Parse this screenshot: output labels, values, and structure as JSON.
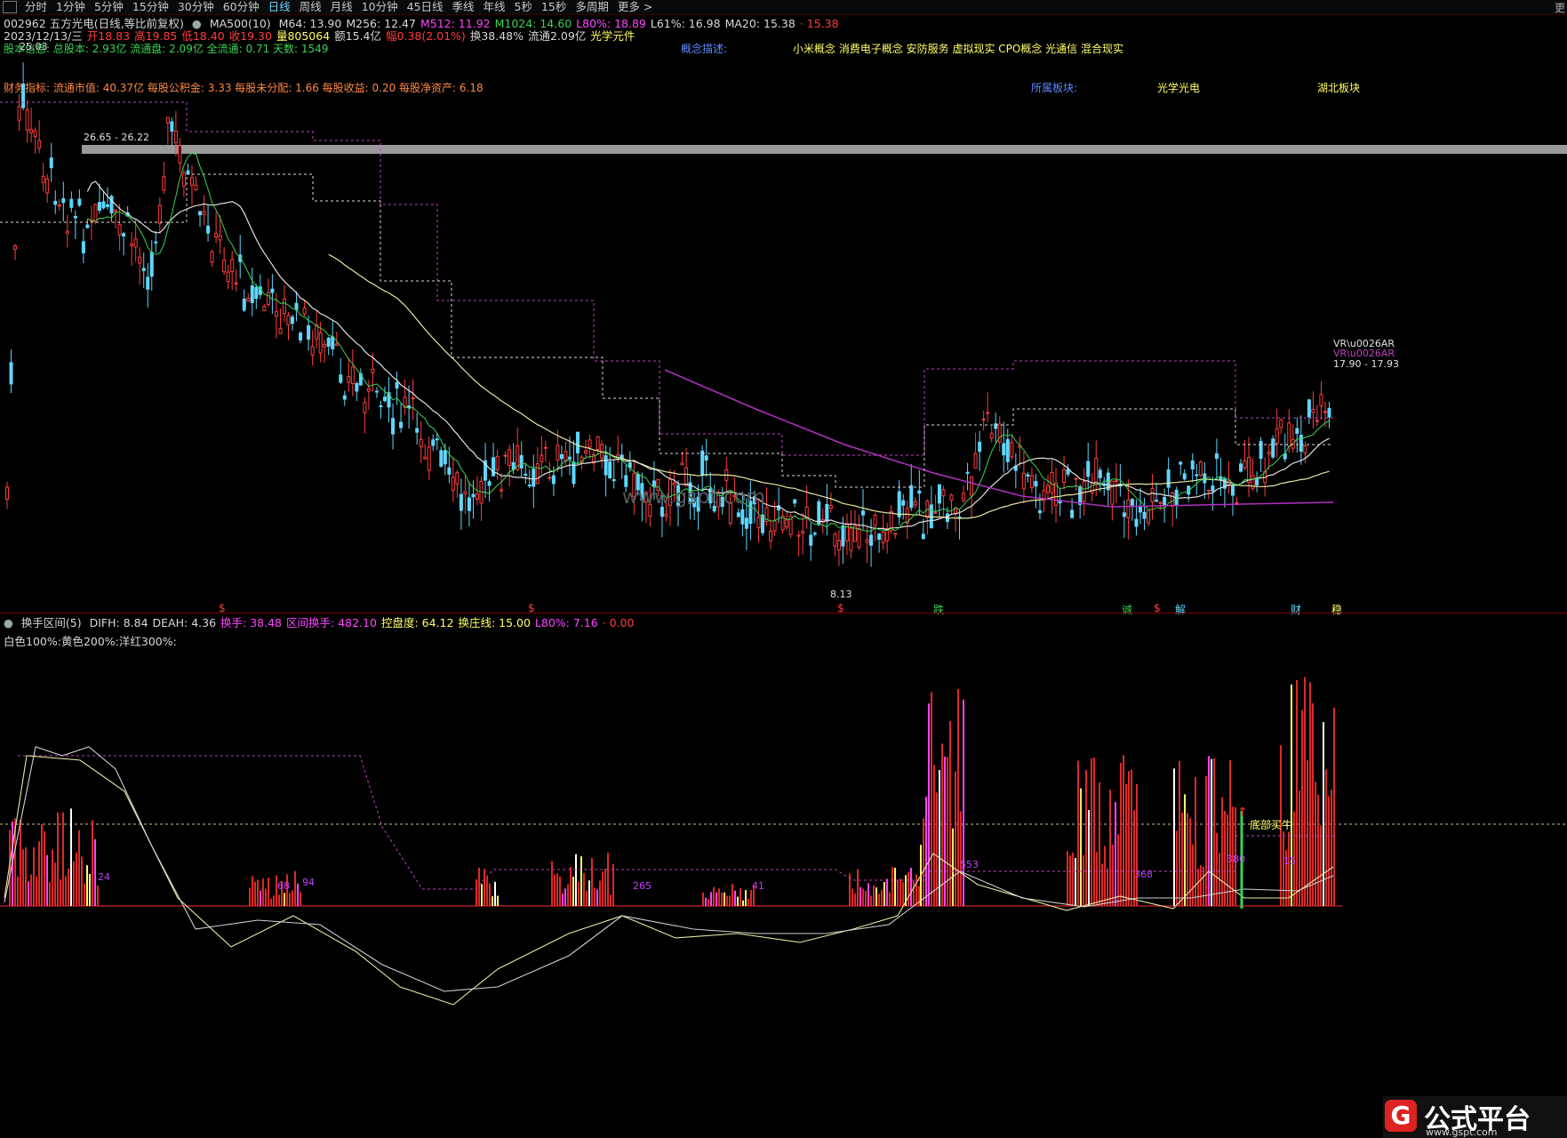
{
  "toolbar": {
    "items": [
      "分时",
      "1分钟",
      "5分钟",
      "15分钟",
      "30分钟",
      "60分钟",
      "日线",
      "周线",
      "月线",
      "10分钟",
      "45日线",
      "季线",
      "年线",
      "5秒",
      "15秒",
      "多周期",
      "更多 >"
    ],
    "active": "日线",
    "right_label": "更"
  },
  "header": {
    "code_name": "002962 五方光电(日线,等比前复权)",
    "ma_label": "MA500(10)",
    "ma_values": [
      {
        "label": "M64: 13.90",
        "color": "#d8d8d8"
      },
      {
        "label": "M256: 12.47",
        "color": "#d8d8d8"
      },
      {
        "label": "M512: 11.92",
        "color": "#ff44ff"
      },
      {
        "label": "M1024: 14.60",
        "color": "#39d353"
      },
      {
        "label": "L80%: 18.89",
        "color": "#ff44ff"
      },
      {
        "label": "L61%: 16.98",
        "color": "#d8d8d8"
      },
      {
        "label": "MA20: 15.38",
        "color": "#d8d8d8"
      },
      {
        "label": "· 15.38",
        "color": "#ff3d3d"
      }
    ],
    "quote": [
      {
        "label": "2023/12/13/三",
        "color": "#d8d8d8"
      },
      {
        "label": "开18.83",
        "color": "#ff3d3d"
      },
      {
        "label": "高19.85",
        "color": "#ff3d3d"
      },
      {
        "label": "低18.40",
        "color": "#ff3d3d"
      },
      {
        "label": "收19.30",
        "color": "#ff3d3d"
      },
      {
        "label": "量805064",
        "color": "#ffff66"
      },
      {
        "label": "额15.4亿",
        "color": "#d8d8d8"
      },
      {
        "label": "幅0.38(2.01%)",
        "color": "#ff3d3d"
      },
      {
        "label": "换38.48%",
        "color": "#d8d8d8"
      },
      {
        "label": "流通2.09亿",
        "color": "#d8d8d8"
      },
      {
        "label": "光学元件",
        "color": "#ffff66"
      }
    ],
    "capital": "股本信息: 总股本: 2.93亿 流通盘: 2.09亿 全流通: 0.71 天数: 1549",
    "concept_label": "概念描述:",
    "concepts": "小米概念 消费电子概念 安防服务 虚拟现实 CPO概念 光通信 混合现实",
    "finance": "财务指标: 流通市值: 40.37亿   每股公积金: 3.33   每股未分配: 1.66   每股收益: 0.20   每股净资产: 6.18",
    "sector_label": "所属板块:",
    "sector1": "光学光电",
    "sector2": "湖北板块"
  },
  "main_chart": {
    "overlay_band_label": "26.65 - 26.22",
    "low_label": "8.13",
    "peak_label": "25.03",
    "right_label1": "VR\\u0026AR",
    "right_label2": "VR\\u0026AR",
    "right_label3": "17.90 - 17.93",
    "watermark": "www.gspt.com",
    "signals": [
      "$",
      "$",
      "$",
      "跌",
      "诚",
      "$",
      "解",
      "财",
      "稳"
    ]
  },
  "indicator": {
    "title": "换手区间(5)",
    "values": [
      {
        "label": "DIFH: 8.84",
        "color": "#d8d8d8"
      },
      {
        "label": "DEAH: 4.36",
        "color": "#d8d8d8"
      },
      {
        "label": "换手: 38.48",
        "color": "#ff44ff"
      },
      {
        "label": "区间换手: 482.10",
        "color": "#ff44ff"
      },
      {
        "label": "控盘度: 64.12",
        "color": "#ffff66"
      },
      {
        "label": "换庄线: 15.00",
        "color": "#ffff66"
      },
      {
        "label": "L80%: 7.16",
        "color": "#ff44ff"
      },
      {
        "label": "· 0.00",
        "color": "#ff3d3d"
      }
    ],
    "legend": "白色100%:黄色200%:洋红300%:",
    "numbers": [
      "24",
      "68",
      "94",
      "265",
      "41",
      "553",
      "368",
      "380",
      "15"
    ],
    "buy_label": "底部买牛"
  },
  "logo": {
    "glyph": "G",
    "title": "公式平台",
    "url": "www.gspt.com"
  },
  "colors": {
    "up": "#ff3d3d",
    "down": "#5fd7ff",
    "ma_yellow": "#e8e8a0",
    "ma_green": "#39d353",
    "magenta": "#c040c0"
  }
}
